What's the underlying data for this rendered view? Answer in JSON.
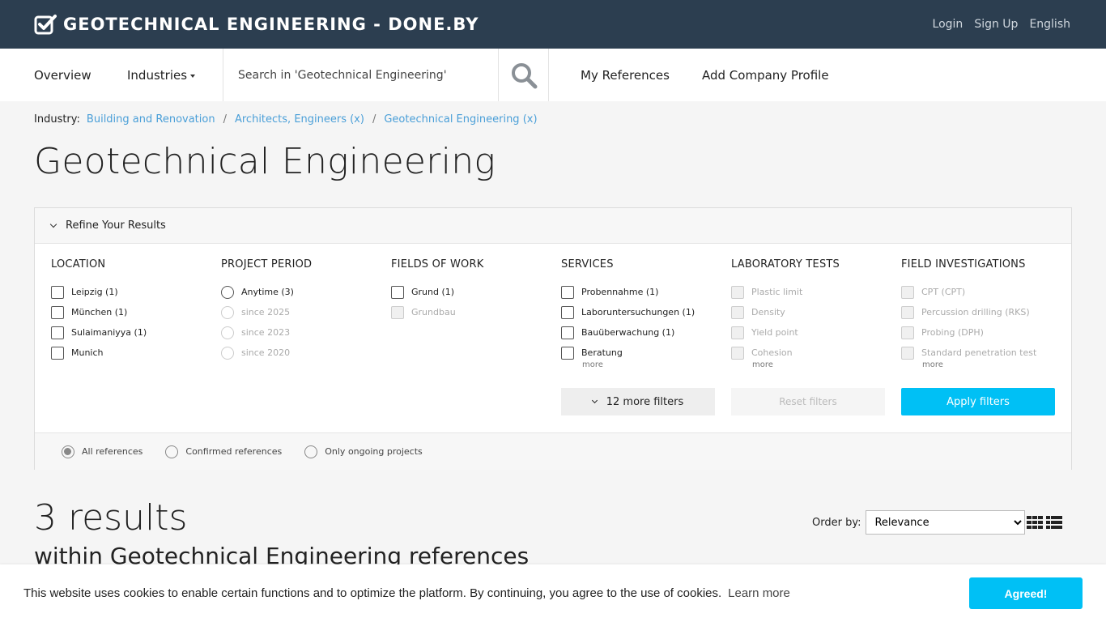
{
  "header": {
    "brand": "GEOTECHNICAL ENGINEERING - DONE.BY",
    "links": [
      "Login",
      "Sign Up",
      "English"
    ]
  },
  "nav": {
    "overview": "Overview",
    "industries": "Industries",
    "search_placeholder": "Search in 'Geotechnical Engineering'",
    "my_references": "My References",
    "add_company": "Add Company Profile"
  },
  "breadcrumb": {
    "label": "Industry:",
    "items": [
      "Building and Renovation",
      "Architects, Engineers (x)",
      "Geotechnical Engineering (x)"
    ],
    "separator": "/"
  },
  "page_title": "Geotechnical Engineering",
  "filters": {
    "header": "Refine Your Results",
    "columns": [
      {
        "title": "LOCATION",
        "options": [
          "Leipzig (1)",
          "München (1)",
          "Sulaimaniyya (1)",
          "Munich"
        ]
      },
      {
        "title": "PROJECT PERIOD",
        "options": [
          "Anytime (3)",
          "since 2025",
          "since 2023",
          "since 2020"
        ]
      },
      {
        "title": "FIELDS OF WORK",
        "options": [
          "Grund (1)",
          "Grundbau"
        ]
      },
      {
        "title": "SERVICES",
        "options": [
          "Probennahme (1)",
          "Laboruntersuchungen (1)",
          "Bauüberwachung (1)",
          "Beratung"
        ],
        "more": "more"
      },
      {
        "title": "LABORATORY TESTS",
        "options": [
          "Plastic limit",
          "Density",
          "Yield point",
          "Cohesion"
        ],
        "more": "more"
      },
      {
        "title": "FIELD INVESTIGATIONS",
        "options": [
          "CPT (CPT)",
          "Percussion drilling (RKS)",
          "Probing (DPH)",
          "Standard penetration test"
        ],
        "more": "more"
      }
    ],
    "more_filters": "12 more filters",
    "reset": "Reset filters",
    "apply": "Apply filters",
    "reference_types": [
      "All references",
      "Confirmed references",
      "Only ongoing projects"
    ]
  },
  "results": {
    "count": "3 results",
    "subtitle": "within Geotechnical Engineering references",
    "order_label": "Order by:",
    "order_value": "Relevance"
  },
  "cookie": {
    "text": "This website uses cookies to enable certain functions and to optimize the platform. By continuing, you agree to the use of cookies.",
    "link": "Learn more",
    "button": "Agreed!"
  },
  "colors": {
    "header_bg": "#2c3e50",
    "accent": "#00c0f5",
    "link": "#4a9fd8"
  }
}
